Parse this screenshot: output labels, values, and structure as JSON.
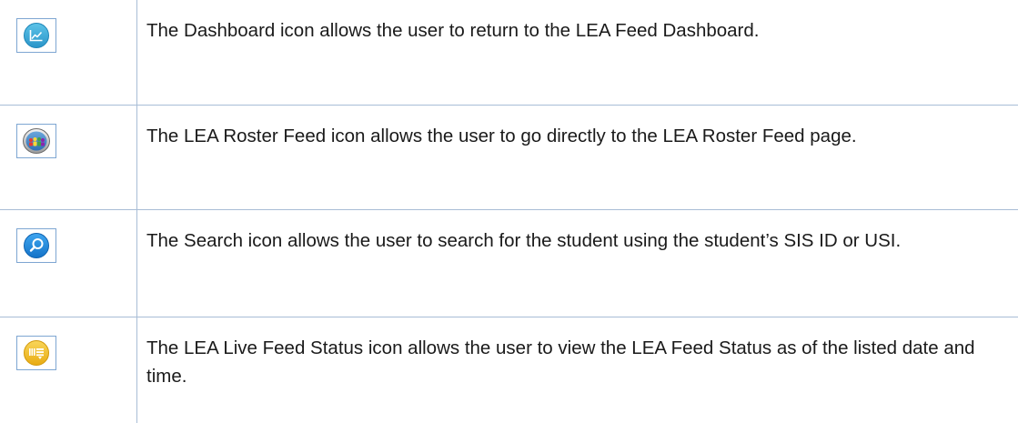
{
  "rows": [
    {
      "icon": "dashboard-icon",
      "description": "The Dashboard icon allows the user to return to the LEA Feed Dashboard."
    },
    {
      "icon": "roster-feed-icon",
      "description": "The LEA Roster Feed icon allows the user to go directly to the LEA Roster Feed page."
    },
    {
      "icon": "search-icon",
      "description": "The Search icon allows the user to search for the student using the student’s SIS ID or USI."
    },
    {
      "icon": "live-feed-status-icon",
      "description": "The LEA Live Feed Status icon allows the user to view the LEA Feed Status as of the listed date and time."
    }
  ],
  "colors": {
    "border": "#a8bdd6",
    "icon_frame": "#7ea6d2",
    "dashboard_icon": "#3aa7d6",
    "search_icon": "#1e8ae0",
    "live_feed_icon": "#f2c12e",
    "text": "#1a1a1a"
  }
}
